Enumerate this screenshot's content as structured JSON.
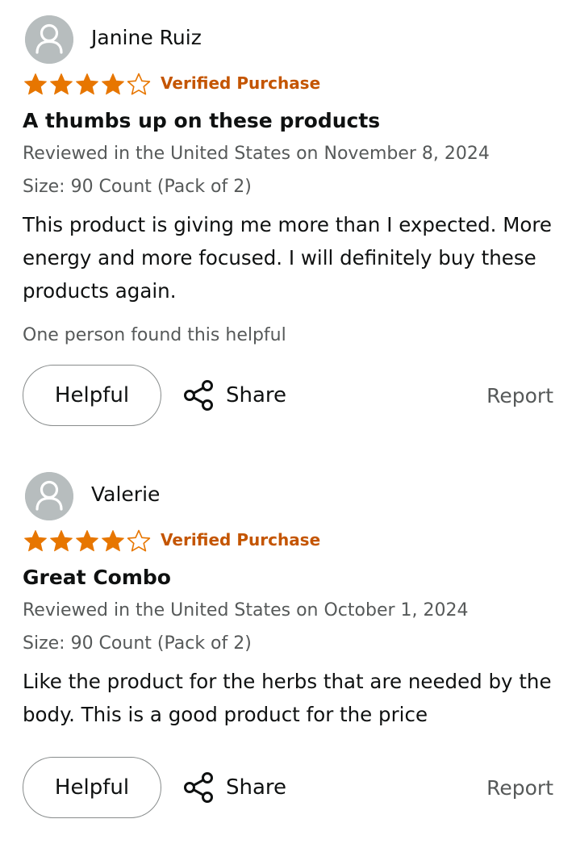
{
  "reviews": [
    {
      "reviewer": "Janine Ruiz",
      "rating": 4,
      "rating_max": 5,
      "verified": "Verified Purchase",
      "title": "A thumbs up on these products",
      "date": "Reviewed in the United States on November 8, 2024",
      "size": "Size: 90 Count (Pack of 2)",
      "body": "This product is giving me more than I expected. More energy and more focused. I will definitely buy these products again.",
      "helpful_count": "One person found this helpful",
      "helpful_label": "Helpful",
      "share_label": "Share",
      "report_label": "Report"
    },
    {
      "reviewer": "Valerie",
      "rating": 4,
      "rating_max": 5,
      "verified": "Verified Purchase",
      "title": "Great Combo",
      "date": "Reviewed in the United States on October 1, 2024",
      "size": "Size: 90 Count (Pack of 2)",
      "body": "Like the product for the herbs that are needed by the body. This is a good product for the price",
      "helpful_count": "",
      "helpful_label": "Helpful",
      "share_label": "Share",
      "report_label": "Report"
    }
  ],
  "colors": {
    "star": "#e77600",
    "verified": "#c45500",
    "text": "#0f1111",
    "muted": "#565959",
    "avatar_bg": "#b7bdbe"
  },
  "icons": {
    "avatar": "person-icon",
    "star": "star-icon",
    "share": "share-icon"
  }
}
